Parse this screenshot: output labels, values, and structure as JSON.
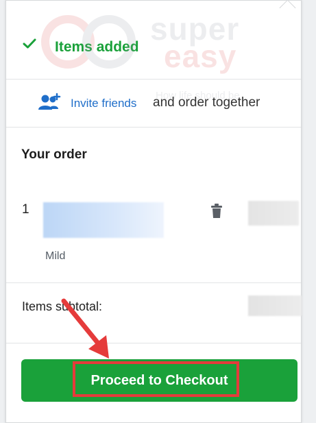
{
  "header": {
    "title": "Items added",
    "check_icon": "check-icon",
    "accent_color": "#1aa13a"
  },
  "watermark": {
    "brand_top": "super",
    "brand_bottom": "easy",
    "tagline": "How life should be"
  },
  "invite": {
    "icon": "add-people-icon",
    "link_label": "Invite friends",
    "rest_text": "and order together",
    "link_color": "#1f6ec9"
  },
  "order": {
    "title": "Your order",
    "items": [
      {
        "quantity": "1",
        "option": "Mild"
      }
    ],
    "delete_icon": "trash-icon"
  },
  "subtotal": {
    "label": "Items subtotal:"
  },
  "checkout": {
    "label": "Proceed to Checkout",
    "button_color": "#1aa13a",
    "highlight_color": "#e53b3b"
  }
}
